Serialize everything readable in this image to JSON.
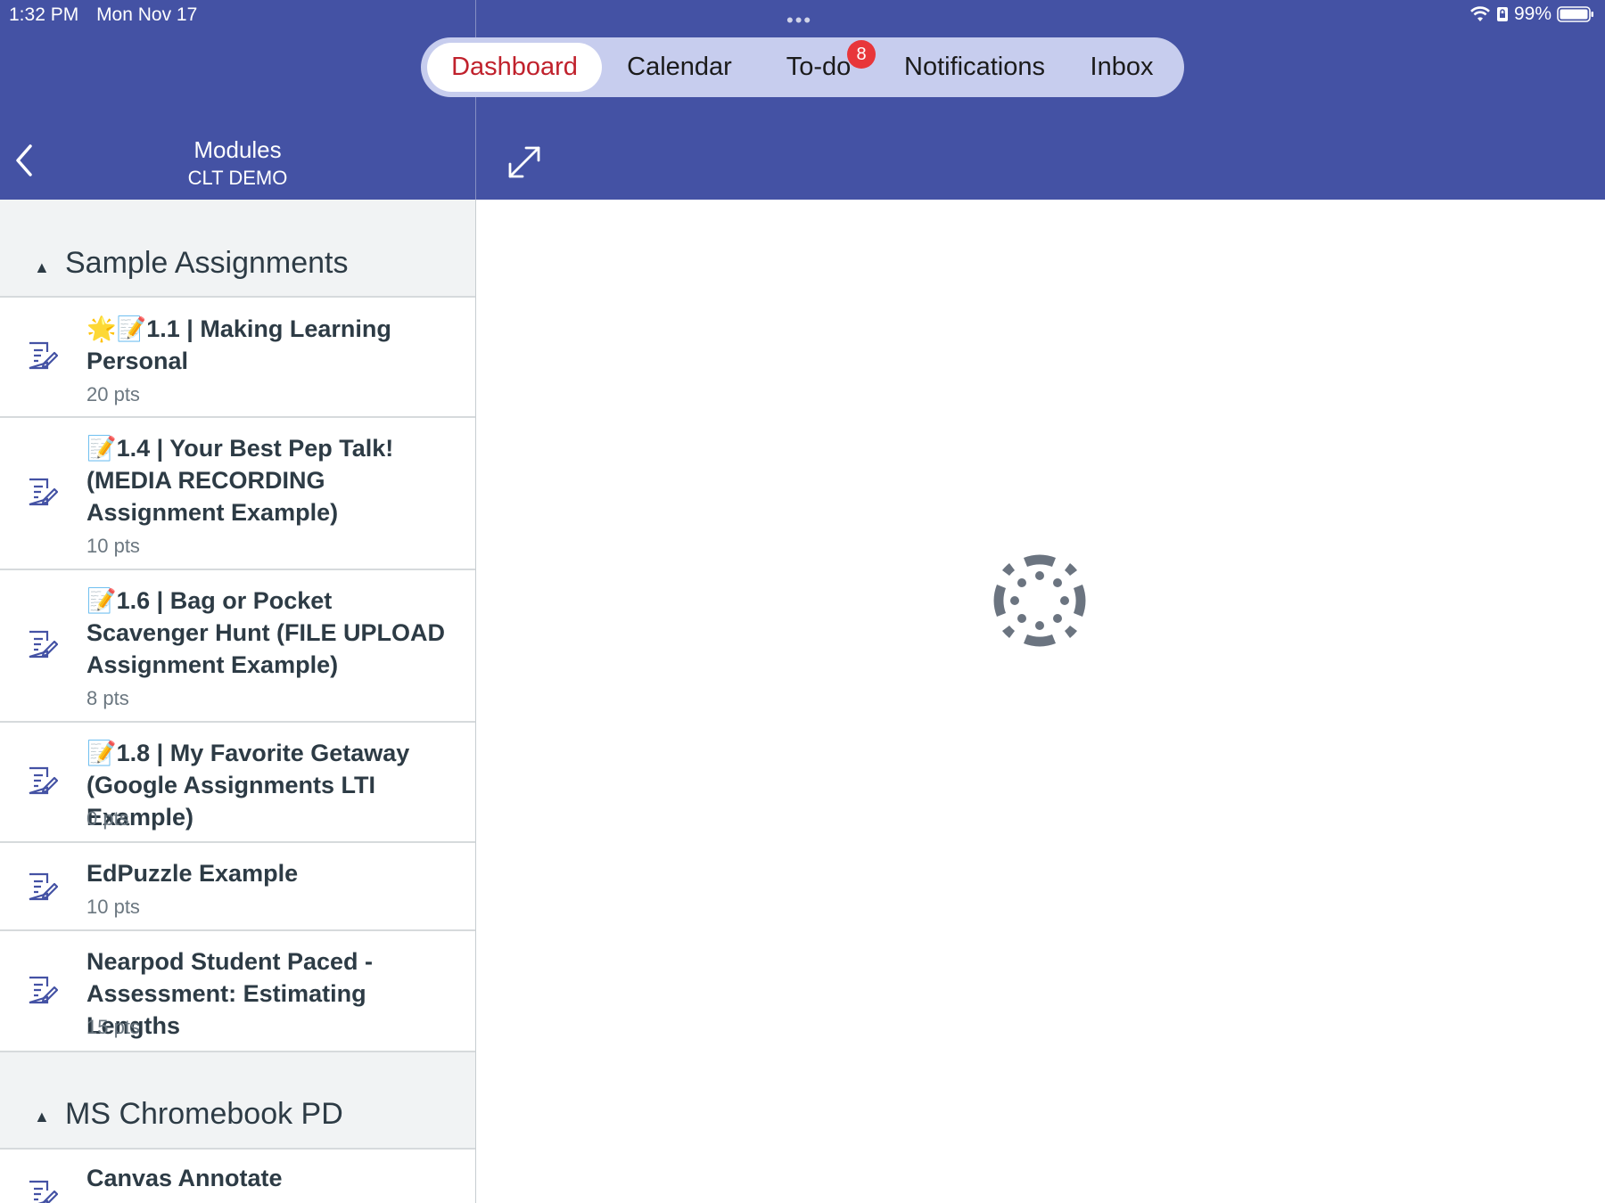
{
  "status": {
    "time": "1:32 PM",
    "date": "Mon Nov 17",
    "battery": "99%"
  },
  "tabs": [
    {
      "label": "Dashboard",
      "active": true
    },
    {
      "label": "Calendar",
      "active": false
    },
    {
      "label": "To-do",
      "active": false,
      "badge": "8"
    },
    {
      "label": "Notifications",
      "active": false
    },
    {
      "label": "Inbox",
      "active": false
    }
  ],
  "header": {
    "title": "Modules",
    "subtitle": "CLT DEMO"
  },
  "modules": [
    {
      "title": "Sample Assignments",
      "items": [
        {
          "emoji": "🌟📝",
          "title": "1.1 | Making Learning Personal",
          "points": "20 pts"
        },
        {
          "emoji": "📝",
          "title": "1.4 | Your Best Pep Talk! (MEDIA RECORDING Assignment Example)",
          "points": "10 pts"
        },
        {
          "emoji": "📝",
          "title": "1.6 | Bag or Pocket Scavenger Hunt (FILE UPLOAD Assignment Example)",
          "points": "8 pts"
        },
        {
          "emoji": "📝",
          "title": "1.8 | My Favorite Getaway (Google Assignments LTI Example)",
          "points": "0 pts"
        },
        {
          "emoji": "",
          "title": "EdPuzzle Example",
          "points": "10 pts"
        },
        {
          "emoji": "",
          "title": "Nearpod Student Paced - Assessment: Estimating Lengths",
          "points": "15 pts"
        }
      ]
    },
    {
      "title": "MS Chromebook PD",
      "items": [
        {
          "emoji": "",
          "title": "Canvas Annotate",
          "points": ""
        }
      ]
    }
  ],
  "colors": {
    "header_bg": "#4452a4",
    "active_tab_text": "#c0212c",
    "badge": "#e8363a",
    "spinner": "#6b7480"
  }
}
